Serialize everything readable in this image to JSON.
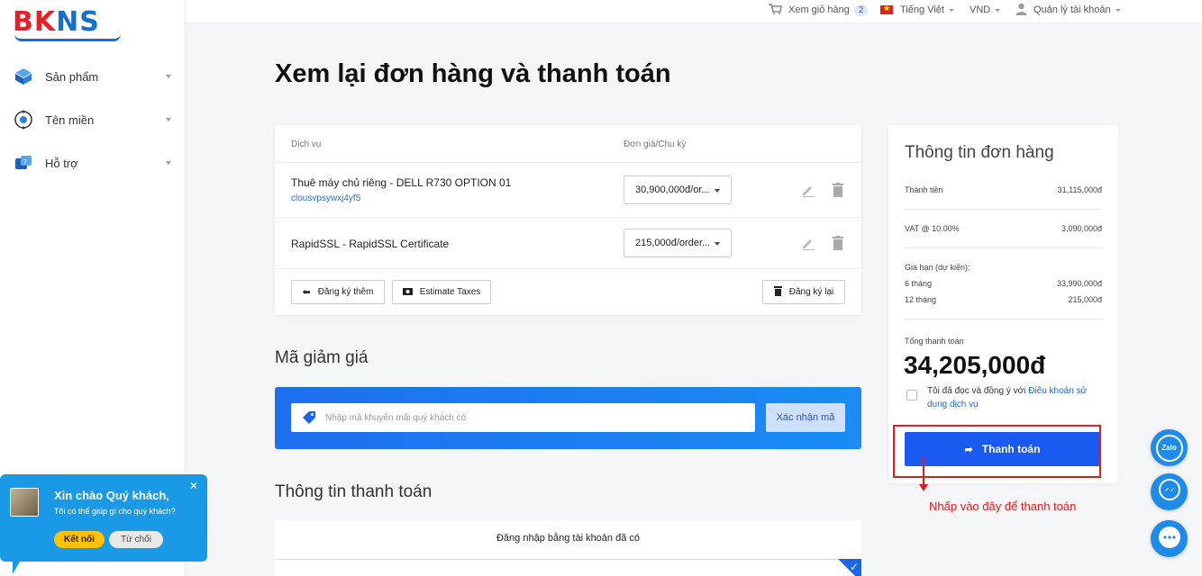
{
  "brand": {
    "logo_text_red": "BK",
    "logo_text_blue": "NS"
  },
  "sidebar": {
    "items": [
      {
        "label": "Sản phẩm",
        "icon": "product-box-icon"
      },
      {
        "label": "Tên miền",
        "icon": "domain-globe-icon"
      },
      {
        "label": "Hỗ trợ",
        "icon": "support-icon"
      }
    ]
  },
  "topbar": {
    "cart_label": "Xem giỏ hàng",
    "cart_count": "2",
    "language": "Tiếng Việt",
    "currency": "VND",
    "account": "Quản lý tài khoản"
  },
  "page": {
    "title": "Xem lại đơn hàng và thanh toán"
  },
  "cart": {
    "col_service": "Dịch vụ",
    "col_price": "Đơn giá/Chu kỳ",
    "rows": [
      {
        "name": "Thuê máy chủ riêng - DELL R730 OPTION 01",
        "sub": "clousvpsywxj4yf5",
        "price": "30,900,000đ/or..."
      },
      {
        "name": "RapidSSL - RapidSSL Certificate",
        "sub": "",
        "price": "215,000đ/order..."
      }
    ],
    "btn_add_more": "Đăng ký thêm",
    "btn_estimate": "Estimate Taxes",
    "btn_reset": "Đăng ký lại"
  },
  "coupon": {
    "section_title": "Mã giảm giá",
    "placeholder": "Nhập mã khuyến mãi quý khách có",
    "button": "Xác nhận mã"
  },
  "payment_info": {
    "section_title": "Thông tin thanh toán",
    "login_option": "Đăng nhập bằng tài khoản đã có"
  },
  "summary": {
    "title": "Thông tin đơn hàng",
    "subtotal_label": "Thành tiền",
    "subtotal_value": "31,115,000đ",
    "vat_label": "VAT @ 10.00%",
    "vat_value": "3,090,000đ",
    "renewal_label": "Gia hạn (dự kiến):",
    "renewals": [
      {
        "term": "6 tháng",
        "value": "33,990,000đ"
      },
      {
        "term": "12 tháng",
        "value": "215,000đ"
      }
    ],
    "total_label": "Tổng thanh toán",
    "total_value": "34,205,000đ",
    "agree_text": "Tôi đã đọc và đồng ý với ",
    "agree_link": "Điều khoản sử dụng dịch vụ",
    "pay_button": "Thanh toán"
  },
  "annotation": {
    "text": "Nhấp vào đây để thanh toán",
    "color": "#e01c1c"
  },
  "chat": {
    "greeting": "Xin chào Quý khách,",
    "subtext": "Tôi có thể giúp gì cho quý khách?",
    "connect": "Kết nối",
    "decline": "Từ chối"
  },
  "floating": {
    "zalo": "Zalo"
  },
  "colors": {
    "primary": "#1a5af0",
    "brand_red": "#e8202a",
    "brand_blue": "#1570c9",
    "chat_blue": "#1a9ae6"
  }
}
